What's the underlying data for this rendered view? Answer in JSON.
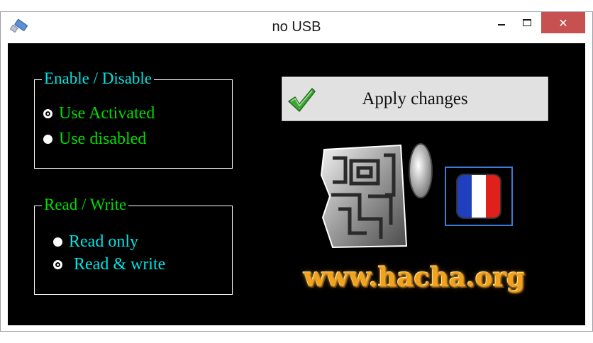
{
  "window": {
    "title": "no USB",
    "app_icon": "usb-drive-icon",
    "controls": {
      "minimize": "minimize-icon",
      "maximize": "maximize-icon",
      "close": "close-icon",
      "close_symbol": "✕"
    }
  },
  "colors": {
    "client_bg": "#000000",
    "green_text": "#00dd00",
    "cyan_text": "#00e5e5",
    "close_button": "#c75050",
    "website_text": "#f2a21b"
  },
  "enable_group": {
    "legend": "Enable / Disable",
    "options": [
      {
        "label": "Use Activated",
        "checked": true
      },
      {
        "label": "Use disabled",
        "checked": false
      }
    ]
  },
  "rw_group": {
    "legend": "Read / Write",
    "options": [
      {
        "label": "Read only",
        "checked": false
      },
      {
        "label": "Read & write",
        "checked": true
      }
    ]
  },
  "apply_button": {
    "label": "Apply changes",
    "icon": "checkmark-icon"
  },
  "emblem": {
    "icon": "hacha-emblem-icon"
  },
  "language_button": {
    "icon": "france-flag-icon",
    "colors": [
      "#1f3fbf",
      "#ffffff",
      "#e0201b"
    ]
  },
  "website": {
    "text": "www.hacha.org"
  }
}
